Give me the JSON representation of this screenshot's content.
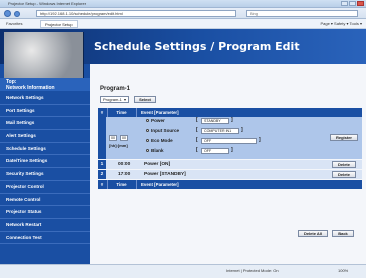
{
  "browser": {
    "window_title": "Projector Setup - Windows Internet Explorer",
    "url": "http://192.168.1.10/schedule/program/edit.html",
    "search_placeholder": "Bing",
    "favorites_label": "Favorites",
    "tab_label": "Projector Setup",
    "toolbar_right": "Page ▾  Safety ▾  Tools ▾",
    "status_zone": "Internet | Protected Mode: On",
    "status_zoom": "100%"
  },
  "header": {
    "title": "Schedule Settings / Program Edit"
  },
  "sidebar": {
    "heading_line1": "Top:",
    "heading_line2": "Network Information",
    "items": [
      {
        "label": "Network Settings"
      },
      {
        "label": "Port Settings"
      },
      {
        "label": "Mail Settings"
      },
      {
        "label": "Alert Settings"
      },
      {
        "label": "Schedule Settings"
      },
      {
        "label": "Date/Time Settings"
      },
      {
        "label": "Security Settings"
      },
      {
        "label": "Projector Control"
      },
      {
        "label": "Remote Control"
      },
      {
        "label": "Projector Status"
      },
      {
        "label": "Network Restart"
      },
      {
        "label": "Connection Test"
      }
    ]
  },
  "main": {
    "program_title": "Program-1",
    "program_select_value": "Program-1",
    "select_button": "Select",
    "table": {
      "col_number": "#",
      "col_time": "Time",
      "col_event": "Event [Parameter]"
    },
    "edit": {
      "hour": "00",
      "minute": "00",
      "time_format": "[hh]:[mm]",
      "options": [
        {
          "label": "Power",
          "value": "STANDBY"
        },
        {
          "label": "Input Source",
          "value": "COMPUTER IN1"
        },
        {
          "label": "Eco Mode",
          "value": "OFF"
        },
        {
          "label": "Blank",
          "value": "OFF"
        }
      ],
      "register_button": "Register"
    },
    "rows": [
      {
        "num": "1",
        "time": "00:00",
        "event": "Power [ON]",
        "delete": "Delete"
      },
      {
        "num": "2",
        "time": "17:00",
        "event": "Power [STANDBY]",
        "delete": "Delete"
      }
    ],
    "delete_all_button": "Delete All",
    "back_button": "Back"
  }
}
